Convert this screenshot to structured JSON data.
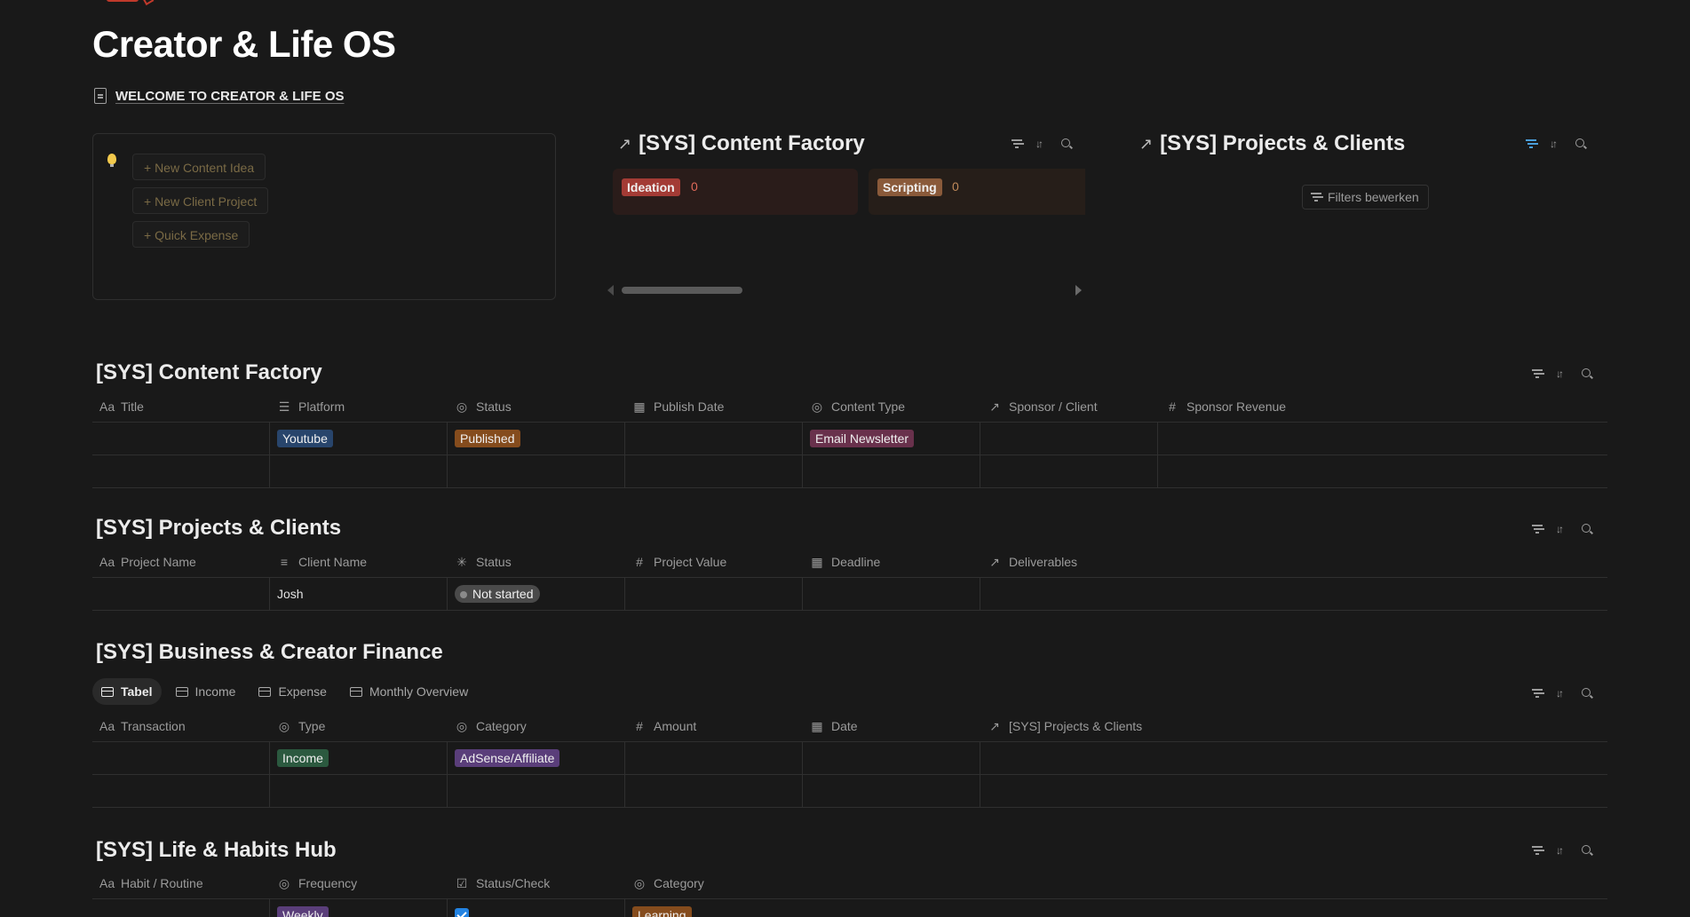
{
  "page": {
    "title": "Creator & Life OS",
    "welcome_link": "WELCOME TO CREATOR & LIFE OS"
  },
  "quick_actions": [
    {
      "label": "+ New Content Idea"
    },
    {
      "label": "+ New Client Project"
    },
    {
      "label": "+ Quick Expense"
    }
  ],
  "linked_content_factory": {
    "title": "[SYS] Content Factory",
    "columns": [
      {
        "label": "Ideation",
        "count": "0",
        "color": "#a33b35",
        "count_color": "#e06a5a",
        "bg": "#2a1c1a"
      },
      {
        "label": "Scripting",
        "count": "0",
        "color": "#8a5a3a",
        "count_color": "#c08a5a",
        "bg": "#261e19"
      }
    ]
  },
  "linked_projects": {
    "title": "[SYS] Projects & Clients",
    "filters_button": "Filters bewerken"
  },
  "content_factory": {
    "title": "[SYS] Content Factory",
    "columns": [
      "Title",
      "Platform",
      "Status",
      "Publish Date",
      "Content Type",
      "Sponsor / Client",
      "Sponsor Revenue"
    ],
    "column_icons": [
      "title-icon",
      "list-icon",
      "status-icon",
      "calendar-icon",
      "select-icon",
      "relation-icon",
      "number-icon"
    ],
    "rows": [
      {
        "title": "",
        "platform": "Youtube",
        "status": "Published",
        "publish_date": "",
        "content_type": "Email Newsletter",
        "sponsor": "",
        "revenue": ""
      },
      {
        "title": "",
        "platform": "",
        "status": "",
        "publish_date": "",
        "content_type": "",
        "sponsor": "",
        "revenue": ""
      }
    ],
    "tag_colors": {
      "Youtube": "#28456c",
      "Published": "#854c1d",
      "Email Newsletter": "#69314c"
    }
  },
  "projects": {
    "title": "[SYS] Projects & Clients",
    "columns": [
      "Project Name",
      "Client Name",
      "Status",
      "Project Value",
      "Deadline",
      "Deliverables"
    ],
    "column_icons": [
      "title-icon",
      "text-icon",
      "status-progress-icon",
      "number-icon",
      "calendar-icon",
      "relation-icon"
    ],
    "rows": [
      {
        "project_name": "",
        "client_name": "Josh",
        "status": "Not started",
        "value": "",
        "deadline": "",
        "deliverables": ""
      }
    ],
    "tag_colors": {
      "Not started": "#4a4a4a"
    }
  },
  "finance": {
    "title": "[SYS] Business & Creator Finance",
    "views": [
      "Tabel",
      "Income",
      "Expense",
      "Monthly Overview"
    ],
    "active_view": "Tabel",
    "columns": [
      "Transaction",
      "Type",
      "Category",
      "Amount",
      "Date",
      "[SYS] Projects & Clients"
    ],
    "column_icons": [
      "title-icon",
      "select-icon",
      "select-icon",
      "number-icon",
      "calendar-icon",
      "relation-icon"
    ],
    "rows": [
      {
        "transaction": "",
        "type": "Income",
        "category": "AdSense/Affiliate",
        "amount": "",
        "date": "",
        "project": ""
      },
      {
        "transaction": "",
        "type": "",
        "category": "",
        "amount": "",
        "date": "",
        "project": ""
      }
    ],
    "tag_colors": {
      "Income": "#2b593f",
      "AdSense/Affiliate": "#5a3e7a"
    }
  },
  "habits": {
    "title": "[SYS] Life & Habits Hub",
    "columns": [
      "Habit / Routine",
      "Frequency",
      "Status/Check",
      "Category"
    ],
    "column_icons": [
      "title-icon",
      "select-icon",
      "checkbox-icon",
      "select-icon"
    ],
    "rows": [
      {
        "habit": "",
        "frequency": "Weekly",
        "checked": true,
        "category": "Learning"
      }
    ],
    "tag_colors": {
      "Weekly": "#5a3e7a",
      "Learning": "#854c1d"
    }
  }
}
